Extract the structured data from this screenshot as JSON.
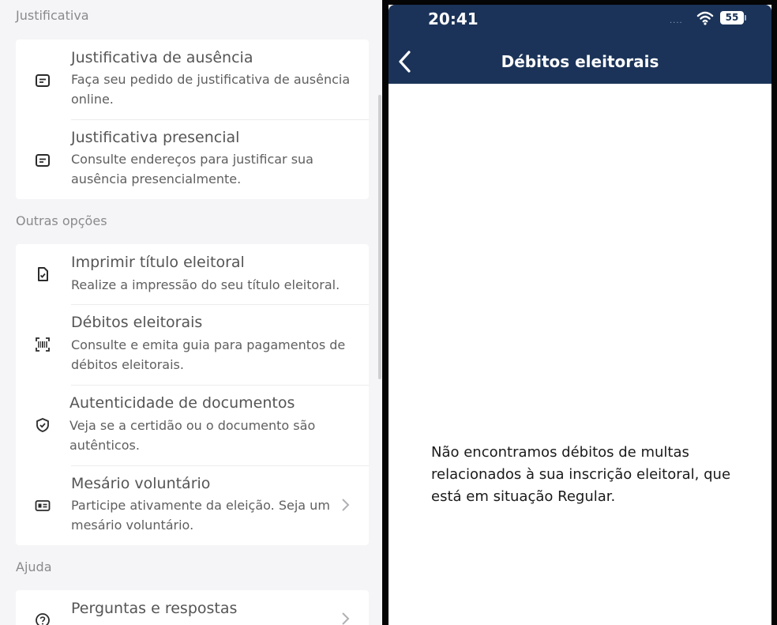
{
  "left_panel": {
    "sections": [
      {
        "label": "Justificativa",
        "items": [
          {
            "title": "Justificativa de ausência",
            "description": "Faça seu pedido de justificativa de ausência online.",
            "icon": "message-icon"
          },
          {
            "title": "Justificativa presencial",
            "description": "Consulte endereços para justificar sua ausência presencialmente.",
            "icon": "message-icon"
          }
        ]
      },
      {
        "label": "Outras opções",
        "items": [
          {
            "title": "Imprimir título eleitoral",
            "description": "Realize a impressão do seu título eleitoral.",
            "icon": "document-check-icon"
          },
          {
            "title": "Débitos eleitorais",
            "description": "Consulte e emita guia para pagamentos de débitos eleitorais.",
            "icon": "barcode-scan-icon"
          },
          {
            "title": "Autenticidade de documentos",
            "description": "Veja se a certidão ou o documento são autênticos.",
            "icon": "shield-check-icon"
          },
          {
            "title": "Mesário voluntário",
            "description": "Participe ativamente da eleição. Seja um mesário voluntário.",
            "icon": "id-card-icon",
            "chevron": true
          }
        ]
      },
      {
        "label": "Ajuda",
        "items": [
          {
            "title": "Perguntas e respostas",
            "icon": "question-circle-icon",
            "chevron": true
          }
        ]
      }
    ]
  },
  "right_panel": {
    "status_bar": {
      "time": "20:41",
      "signal": "....",
      "battery": "55"
    },
    "header": {
      "title": "Débitos eleitorais",
      "back_icon": "chevron-left-icon"
    },
    "message": "Não encontramos débitos de multas relacionados à sua inscrição eleitoral, que está em situação Regular."
  },
  "colors": {
    "header_bg": "#1b3358",
    "left_bg": "#f5f5f7",
    "card_bg": "#ffffff",
    "text_primary": "#555555"
  }
}
